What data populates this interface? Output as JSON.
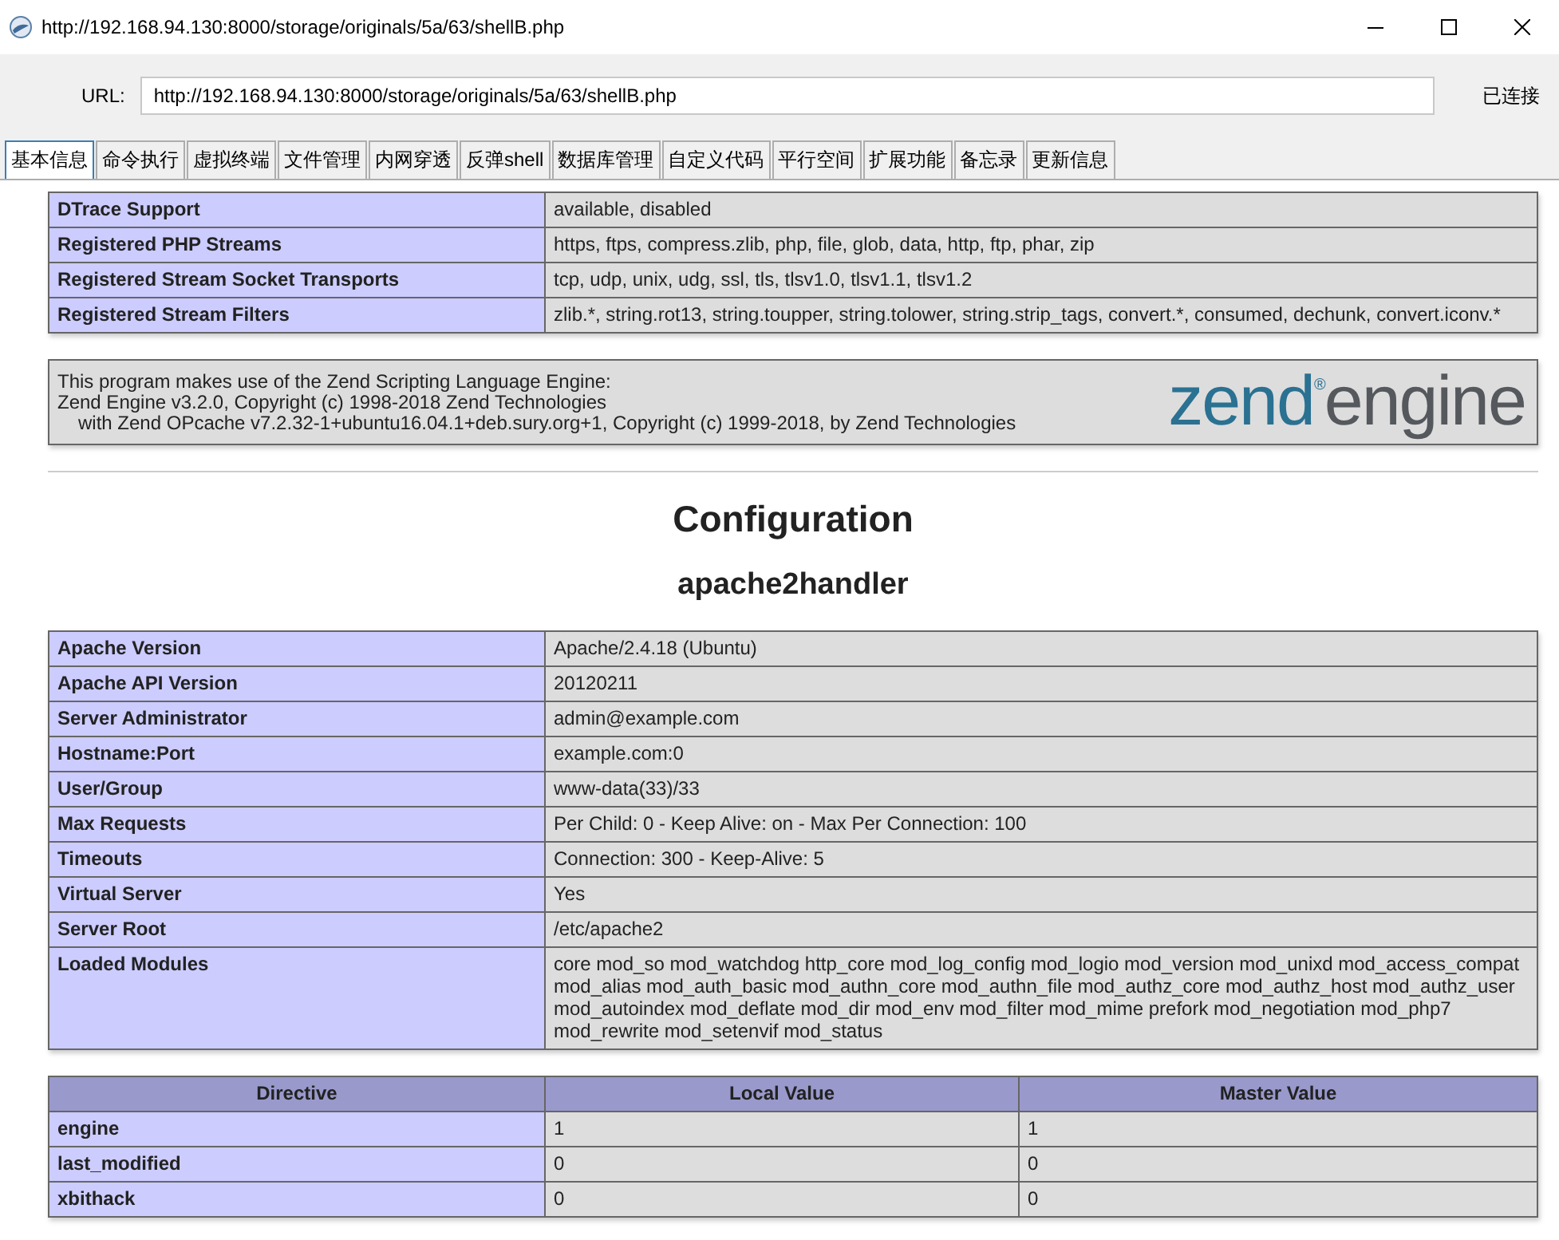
{
  "window": {
    "title": "http://192.168.94.130:8000/storage/originals/5a/63/shellB.php"
  },
  "address_bar": {
    "label": "URL:",
    "value": "http://192.168.94.130:8000/storage/originals/5a/63/shellB.php",
    "status": "已连接"
  },
  "tabs": [
    {
      "label": "基本信息",
      "selected": true
    },
    {
      "label": "命令执行",
      "selected": false
    },
    {
      "label": "虚拟终端",
      "selected": false
    },
    {
      "label": "文件管理",
      "selected": false
    },
    {
      "label": "内网穿透",
      "selected": false
    },
    {
      "label": "反弹shell",
      "selected": false
    },
    {
      "label": "数据库管理",
      "selected": false
    },
    {
      "label": "自定义代码",
      "selected": false
    },
    {
      "label": "平行空间",
      "selected": false
    },
    {
      "label": "扩展功能",
      "selected": false
    },
    {
      "label": "备忘录",
      "selected": false
    },
    {
      "label": "更新信息",
      "selected": false
    }
  ],
  "top_table": {
    "rows": [
      {
        "name": "DTrace Support",
        "value": "available, disabled"
      },
      {
        "name": "Registered PHP Streams",
        "value": "https, ftps, compress.zlib, php, file, glob, data, http, ftp, phar, zip"
      },
      {
        "name": "Registered Stream Socket Transports",
        "value": "tcp, udp, unix, udg, ssl, tls, tlsv1.0, tlsv1.1, tlsv1.2"
      },
      {
        "name": "Registered Stream Filters",
        "value": "zlib.*, string.rot13, string.toupper, string.tolower, string.strip_tags, convert.*, consumed, dechunk, convert.iconv.*"
      }
    ]
  },
  "zend_box": {
    "lines": [
      {
        "text": "This program makes use of the Zend Scripting Language Engine:",
        "indented": false
      },
      {
        "text": "Zend Engine v3.2.0, Copyright (c) 1998-2018 Zend Technologies",
        "indented": false
      },
      {
        "text": "with Zend OPcache v7.2.32-1+ubuntu16.04.1+deb.sury.org+1, Copyright (c) 1999-2018, by Zend Technologies",
        "indented": true
      }
    ],
    "logo": {
      "word_1": "zend",
      "mark": "®",
      "word_2": "engine"
    }
  },
  "heading": "Configuration",
  "subheading": "apache2handler",
  "info_table": {
    "rows": [
      {
        "name": "Apache Version",
        "value": "Apache/2.4.18 (Ubuntu)"
      },
      {
        "name": "Apache API Version",
        "value": "20120211"
      },
      {
        "name": "Server Administrator",
        "value": "admin@example.com"
      },
      {
        "name": "Hostname:Port",
        "value": "example.com:0"
      },
      {
        "name": "User/Group",
        "value": "www-data(33)/33"
      },
      {
        "name": "Max Requests",
        "value": "Per Child: 0 - Keep Alive: on - Max Per Connection: 100"
      },
      {
        "name": "Timeouts",
        "value": "Connection: 300 - Keep-Alive: 5"
      },
      {
        "name": "Virtual Server",
        "value": "Yes"
      },
      {
        "name": "Server Root",
        "value": "/etc/apache2"
      },
      {
        "name": "Loaded Modules",
        "value": "core mod_so mod_watchdog http_core mod_log_config mod_logio mod_version mod_unixd mod_access_compat mod_alias mod_auth_basic mod_authn_core mod_authn_file mod_authz_core mod_authz_host mod_authz_user mod_autoindex mod_deflate mod_dir mod_env mod_filter mod_mime prefork mod_negotiation mod_php7 mod_rewrite mod_setenvif mod_status"
      }
    ]
  },
  "directive_table": {
    "columns": [
      "Directive",
      "Local Value",
      "Master Value"
    ],
    "rows": [
      [
        "engine",
        "1",
        "1"
      ],
      [
        "last_modified",
        "0",
        "0"
      ],
      [
        "xbithack",
        "0",
        "0"
      ]
    ]
  }
}
